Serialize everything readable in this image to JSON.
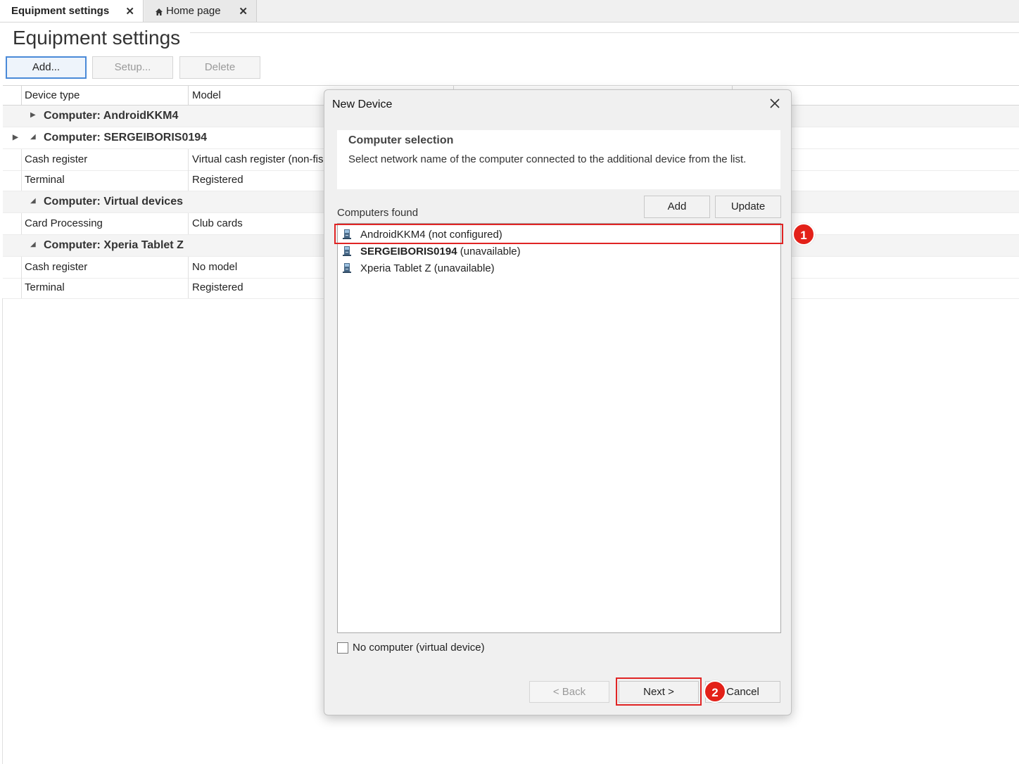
{
  "tabs": [
    {
      "label": "Equipment settings",
      "active": true
    },
    {
      "label": "Home page",
      "active": false
    }
  ],
  "page": {
    "title": "Equipment settings"
  },
  "toolbar": {
    "add": "Add...",
    "setup": "Setup...",
    "delete": "Delete"
  },
  "grid": {
    "columns": [
      "Device type",
      "Model"
    ],
    "groups": [
      {
        "label": "Computer: AndroidKKM4",
        "expanded": false,
        "rows": []
      },
      {
        "label": "Computer: SERGEIBORIS0194",
        "expanded": true,
        "rows": [
          {
            "type": "Cash register",
            "model": "Virtual cash register (non-fisc"
          },
          {
            "type": "Terminal",
            "model": "Registered"
          }
        ]
      },
      {
        "label": "Computer: Virtual devices",
        "expanded": true,
        "rows": [
          {
            "type": "Card Processing",
            "model": "Club cards"
          }
        ]
      },
      {
        "label": "Computer: Xperia Tablet Z",
        "expanded": true,
        "rows": [
          {
            "type": "Cash register",
            "model": "No model"
          },
          {
            "type": "Terminal",
            "model": "Registered"
          }
        ]
      }
    ]
  },
  "dialog": {
    "title": "New Device",
    "section_title": "Computer selection",
    "section_desc": "Select network name of the computer connected to the additional device from the list.",
    "found_label": "Computers found",
    "add_button": "Add",
    "update_button": "Update",
    "computers": [
      {
        "name": "AndroidKKM4 (not configured)",
        "selected": true
      },
      {
        "name_bold": "SERGEIBORIS0194",
        "suffix": " (unavailable)"
      },
      {
        "name": "Xperia Tablet Z (unavailable)"
      }
    ],
    "no_computer_label": "No computer (virtual device)",
    "no_computer_checked": false,
    "back_button": "< Back",
    "next_button": "Next >",
    "cancel_button": "Cancel"
  },
  "annotations": {
    "badge1": "1",
    "badge2": "2",
    "highlight_color": "#e02424"
  }
}
